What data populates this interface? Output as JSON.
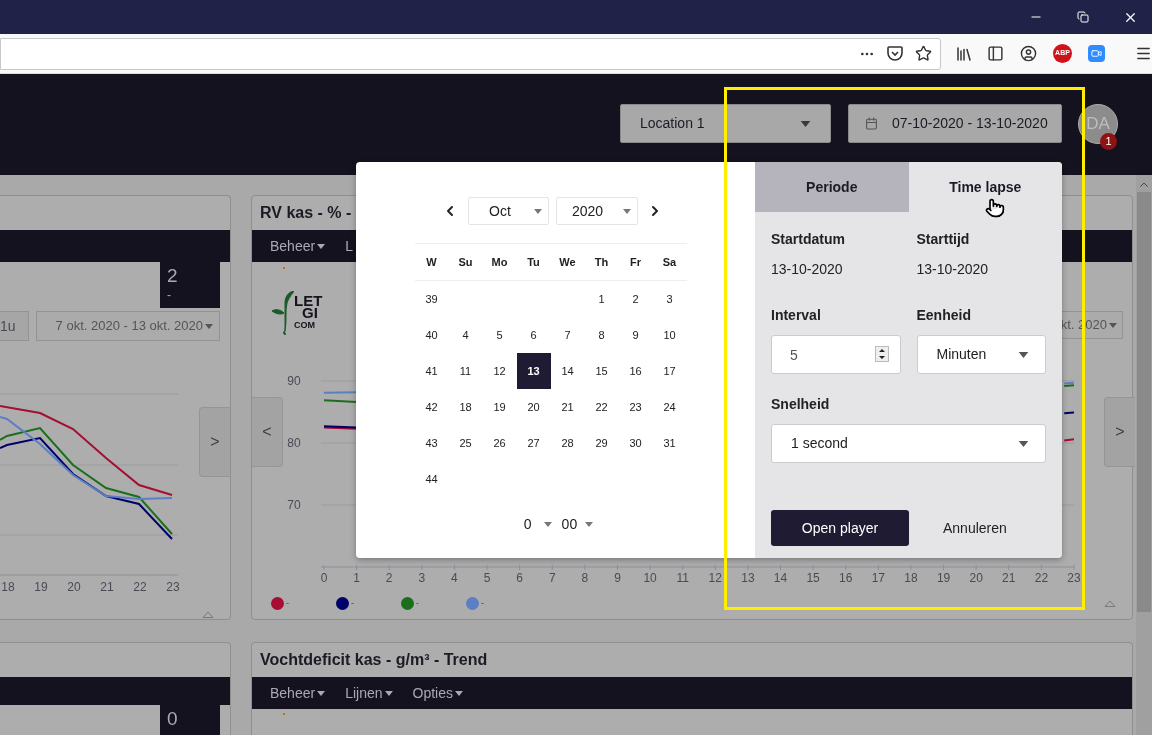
{
  "browser": {
    "extension_badge": "ABP"
  },
  "app_header": {
    "location_select": "Location 1",
    "date_range": "07-10-2020 - 13-10-2020",
    "avatar": {
      "initials": "DA",
      "badge": "1"
    }
  },
  "card_top_left": {
    "badge_value": "2",
    "badge_sub": "-",
    "interval_button": "1u",
    "range_select": "7 okt. 2020 - 13 okt. 2020",
    "next_button": ">",
    "x_axis_labels": [
      "18",
      "19",
      "20",
      "21",
      "22",
      "23"
    ]
  },
  "card_top_right": {
    "title": "RV kas - % -",
    "menu": [
      "Beheer",
      "L"
    ],
    "logo_lines": [
      "LET",
      "GI",
      "COM"
    ],
    "range_select": "kt. 2020",
    "prev_button": "<",
    "next_button": ">",
    "chart_data": {
      "type": "line",
      "x": [
        0,
        1,
        22.7,
        23
      ],
      "xlim": [
        0,
        23
      ],
      "ylim": [
        60,
        90
      ],
      "xticks": [
        0,
        1,
        2,
        3,
        4,
        5,
        6,
        7,
        8,
        9,
        10,
        11,
        12,
        13,
        14,
        15,
        16,
        17,
        18,
        19,
        20,
        21,
        22,
        23
      ],
      "yticks": [
        70,
        80,
        90
      ],
      "grid": true,
      "series": [
        {
          "name": "-",
          "color": "#a50d33",
          "values": [
            82.5,
            82.3,
            80.4,
            80.6
          ]
        },
        {
          "name": "-",
          "color": "#00006b",
          "values": [
            82.7,
            82.5,
            84.8,
            84.9
          ]
        },
        {
          "name": "-",
          "color": "#1b6e1b",
          "values": [
            86.9,
            86.6,
            89.2,
            89.3
          ]
        },
        {
          "name": "-",
          "color": "#5a7fc4",
          "values": [
            88.1,
            88.2,
            89.6,
            89.7
          ]
        }
      ]
    }
  },
  "card_bottom_left": {
    "badge_value": "0"
  },
  "card_bottom_right": {
    "title": "Vochtdeficit kas - g/m³ - Trend",
    "menu": [
      "Beheer",
      "Lijnen",
      "Opties"
    ]
  },
  "date_picker": {
    "month": "Oct",
    "year": "2020",
    "weekdays": [
      "W",
      "Su",
      "Mo",
      "Tu",
      "We",
      "Th",
      "Fr",
      "Sa"
    ],
    "weeks": [
      {
        "week": "39",
        "days": [
          {
            "kind": "blank"
          },
          {
            "kind": "blank"
          },
          {
            "kind": "blank"
          },
          {
            "kind": "blank"
          },
          {
            "kind": "day",
            "label": "1",
            "selected": false
          },
          {
            "kind": "day",
            "label": "2",
            "selected": false
          },
          {
            "kind": "day",
            "label": "3",
            "selected": false
          }
        ]
      },
      {
        "week": "40",
        "days": [
          {
            "kind": "day",
            "label": "4",
            "selected": false
          },
          {
            "kind": "day",
            "label": "5",
            "selected": false
          },
          {
            "kind": "day",
            "label": "6",
            "selected": false
          },
          {
            "kind": "day",
            "label": "7",
            "selected": false
          },
          {
            "kind": "day",
            "label": "8",
            "selected": false
          },
          {
            "kind": "day",
            "label": "9",
            "selected": false
          },
          {
            "kind": "day",
            "label": "10",
            "selected": false
          }
        ]
      },
      {
        "week": "41",
        "days": [
          {
            "kind": "day",
            "label": "11",
            "selected": false
          },
          {
            "kind": "day",
            "label": "12",
            "selected": false
          },
          {
            "kind": "day",
            "label": "13",
            "selected": true
          },
          {
            "kind": "day",
            "label": "14",
            "selected": false
          },
          {
            "kind": "day",
            "label": "15",
            "selected": false
          },
          {
            "kind": "day",
            "label": "16",
            "selected": false
          },
          {
            "kind": "day",
            "label": "17",
            "selected": false
          }
        ]
      },
      {
        "week": "42",
        "days": [
          {
            "kind": "day",
            "label": "18",
            "selected": false
          },
          {
            "kind": "day",
            "label": "19",
            "selected": false
          },
          {
            "kind": "day",
            "label": "20",
            "selected": false
          },
          {
            "kind": "day",
            "label": "21",
            "selected": false
          },
          {
            "kind": "day",
            "label": "22",
            "selected": false
          },
          {
            "kind": "day",
            "label": "23",
            "selected": false
          },
          {
            "kind": "day",
            "label": "24",
            "selected": false
          }
        ]
      },
      {
        "week": "43",
        "days": [
          {
            "kind": "day",
            "label": "25",
            "selected": false
          },
          {
            "kind": "day",
            "label": "26",
            "selected": false
          },
          {
            "kind": "day",
            "label": "27",
            "selected": false
          },
          {
            "kind": "day",
            "label": "28",
            "selected": false
          },
          {
            "kind": "day",
            "label": "29",
            "selected": false
          },
          {
            "kind": "day",
            "label": "30",
            "selected": false
          },
          {
            "kind": "day",
            "label": "31",
            "selected": false
          }
        ]
      },
      {
        "week": "44"
      }
    ],
    "hour": "0",
    "minute": "00"
  },
  "time_lapse_panel": {
    "tabs": [
      {
        "label": "Periode",
        "selected": false
      },
      {
        "label": "Time lapse",
        "selected": true
      }
    ],
    "start_date": {
      "label": "Startdatum",
      "value": "13-10-2020"
    },
    "start_time": {
      "label": "Starttijd",
      "value": "13-10-2020"
    },
    "interval": {
      "label": "Interval",
      "value": "5"
    },
    "unit": {
      "label": "Eenheid",
      "value": "Minuten"
    },
    "speed": {
      "label": "Snelheid",
      "value": "1 second"
    },
    "open_button": "Open player",
    "cancel_button": "Annuleren"
  }
}
